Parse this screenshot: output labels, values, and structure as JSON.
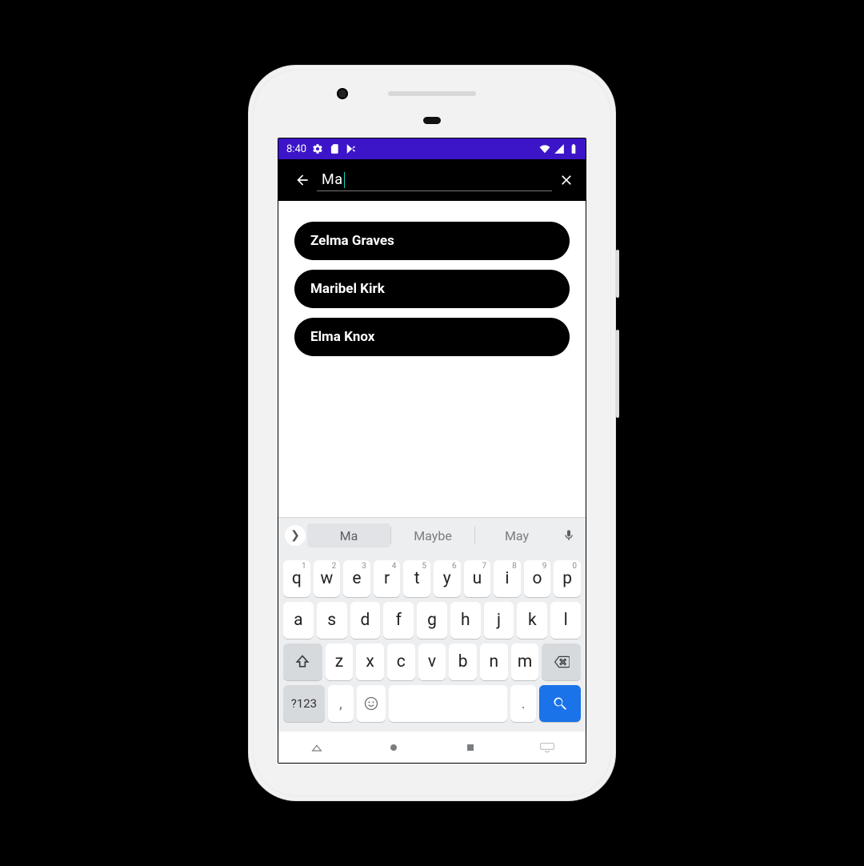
{
  "status": {
    "time": "8:40"
  },
  "search_bar": {
    "query": "Ma",
    "clear_aria": "Clear",
    "back_aria": "Back"
  },
  "results": [
    {
      "name": "Zelma Graves"
    },
    {
      "name": "Maribel Kirk"
    },
    {
      "name": "Elma Knox"
    }
  ],
  "keyboard": {
    "suggestions": [
      "Ma",
      "Maybe",
      "May"
    ],
    "row1": [
      {
        "k": "q",
        "h": "1"
      },
      {
        "k": "w",
        "h": "2"
      },
      {
        "k": "e",
        "h": "3"
      },
      {
        "k": "r",
        "h": "4"
      },
      {
        "k": "t",
        "h": "5"
      },
      {
        "k": "y",
        "h": "6"
      },
      {
        "k": "u",
        "h": "7"
      },
      {
        "k": "i",
        "h": "8"
      },
      {
        "k": "o",
        "h": "9"
      },
      {
        "k": "p",
        "h": "0"
      }
    ],
    "row2": [
      {
        "k": "a"
      },
      {
        "k": "s"
      },
      {
        "k": "d"
      },
      {
        "k": "f"
      },
      {
        "k": "g"
      },
      {
        "k": "h"
      },
      {
        "k": "j"
      },
      {
        "k": "k"
      },
      {
        "k": "l"
      }
    ],
    "row3": [
      {
        "k": "z"
      },
      {
        "k": "x"
      },
      {
        "k": "c"
      },
      {
        "k": "v"
      },
      {
        "k": "b"
      },
      {
        "k": "n"
      },
      {
        "k": "m"
      }
    ],
    "symbols_key": "?123",
    "comma": ",",
    "period": "."
  }
}
